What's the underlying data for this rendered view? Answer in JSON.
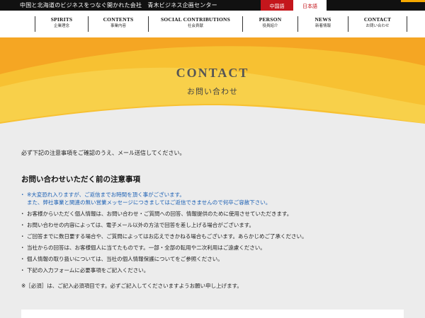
{
  "topbar": {
    "tagline": "中国と北海道のビジネスをつなぐ開かれた会社　青木ビジネス企画センター",
    "lang_cn": "中国語",
    "lang_jp": "日本語"
  },
  "nav": [
    {
      "en": "SPIRITS",
      "jp": "企業理念"
    },
    {
      "en": "CONTENTS",
      "jp": "事業内容"
    },
    {
      "en": "SOCIAL CONTRIBUTIONS",
      "jp": "社会貢献"
    },
    {
      "en": "PERSON",
      "jp": "役員紹介"
    },
    {
      "en": "NEWS",
      "jp": "新着情報"
    },
    {
      "en": "CONTACT",
      "jp": "お問い合わせ"
    }
  ],
  "hero": {
    "title": "CONTACT",
    "subtitle": "お問い合わせ"
  },
  "main": {
    "intro": "必ず下記の注意事項をご確認のうえ、メール送信してください。",
    "heading": "お問い合わせいただく前の注意事項",
    "notice_line1": "※大変恐れ入りますが、ご返信までお時間を頂く事がございます。",
    "notice_line2": "また、弊社事業と関連の無い営業メッセージにつきましてはご返信できませんので何卒ご容赦下さい。",
    "notes": [
      "お客様からいただく個人情報は、お問い合わせ・ご質問への回答、情報提供のために使用させていただきます。",
      "お問い合わせの内容によっては、電子メール以外の方法で回答を差し上げる場合がございます。",
      "ご回答までに数日要する場合や、ご質問によってはお応えできかねる場合もございます。あらかじめご了承ください。",
      "当社からの回答は、お客様個人に当てたものです。一部・全部の転用や二次利用はご遠慮ください。",
      "個人情報の取り扱いについては、当社の個人情報保護についてをご参照ください。",
      "下記の入力フォームに必要事項をご記入ください。"
    ],
    "required_note": "※［必須］は、ご記入必須項目です。必ずご記入してくださいますようお願い申し上げます。"
  },
  "colors": {
    "accent_red": "#c4161c",
    "hero_yellow": "#f7c132",
    "hero_orange": "#f5a623",
    "link_blue": "#1a5fb4"
  }
}
